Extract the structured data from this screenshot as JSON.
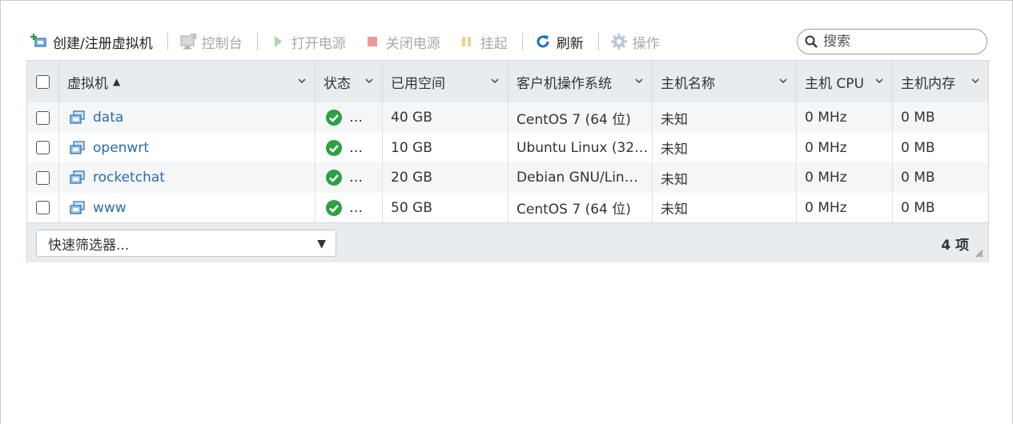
{
  "toolbar": {
    "create_label": "创建/注册虚拟机",
    "console_label": "控制台",
    "power_on_label": "打开电源",
    "power_off_label": "关闭电源",
    "suspend_label": "挂起",
    "refresh_label": "刷新",
    "actions_label": "操作"
  },
  "search": {
    "placeholder": "搜索"
  },
  "columns": {
    "vm": "虚拟机",
    "status": "状态",
    "used_space": "已用空间",
    "guest_os": "客户机操作系统",
    "host_name": "主机名称",
    "host_cpu": "主机 CPU",
    "host_memory": "主机内存"
  },
  "rows": [
    {
      "name": "data",
      "status": "…",
      "used_space": "40 GB",
      "guest_os": "CentOS 7 (64 位)",
      "host_name": "未知",
      "host_cpu": "0 MHz",
      "host_memory": "0 MB"
    },
    {
      "name": "openwrt",
      "status": "…",
      "used_space": "10 GB",
      "guest_os": "Ubuntu Linux (32…",
      "host_name": "未知",
      "host_cpu": "0 MHz",
      "host_memory": "0 MB"
    },
    {
      "name": "rocketchat",
      "status": "…",
      "used_space": "20 GB",
      "guest_os": "Debian GNU/Lin…",
      "host_name": "未知",
      "host_cpu": "0 MHz",
      "host_memory": "0 MB"
    },
    {
      "name": "www",
      "status": "…",
      "used_space": "50 GB",
      "guest_os": "CentOS 7 (64 位)",
      "host_name": "未知",
      "host_cpu": "0 MHz",
      "host_memory": "0 MB"
    }
  ],
  "footer": {
    "quick_filter": "快速筛选器...",
    "item_count": "4 项"
  },
  "colors": {
    "link": "#2b6ea6",
    "status_ok": "#2ea043",
    "header_bg": "#e9ecef",
    "refresh_blue": "#1f6fc4"
  }
}
